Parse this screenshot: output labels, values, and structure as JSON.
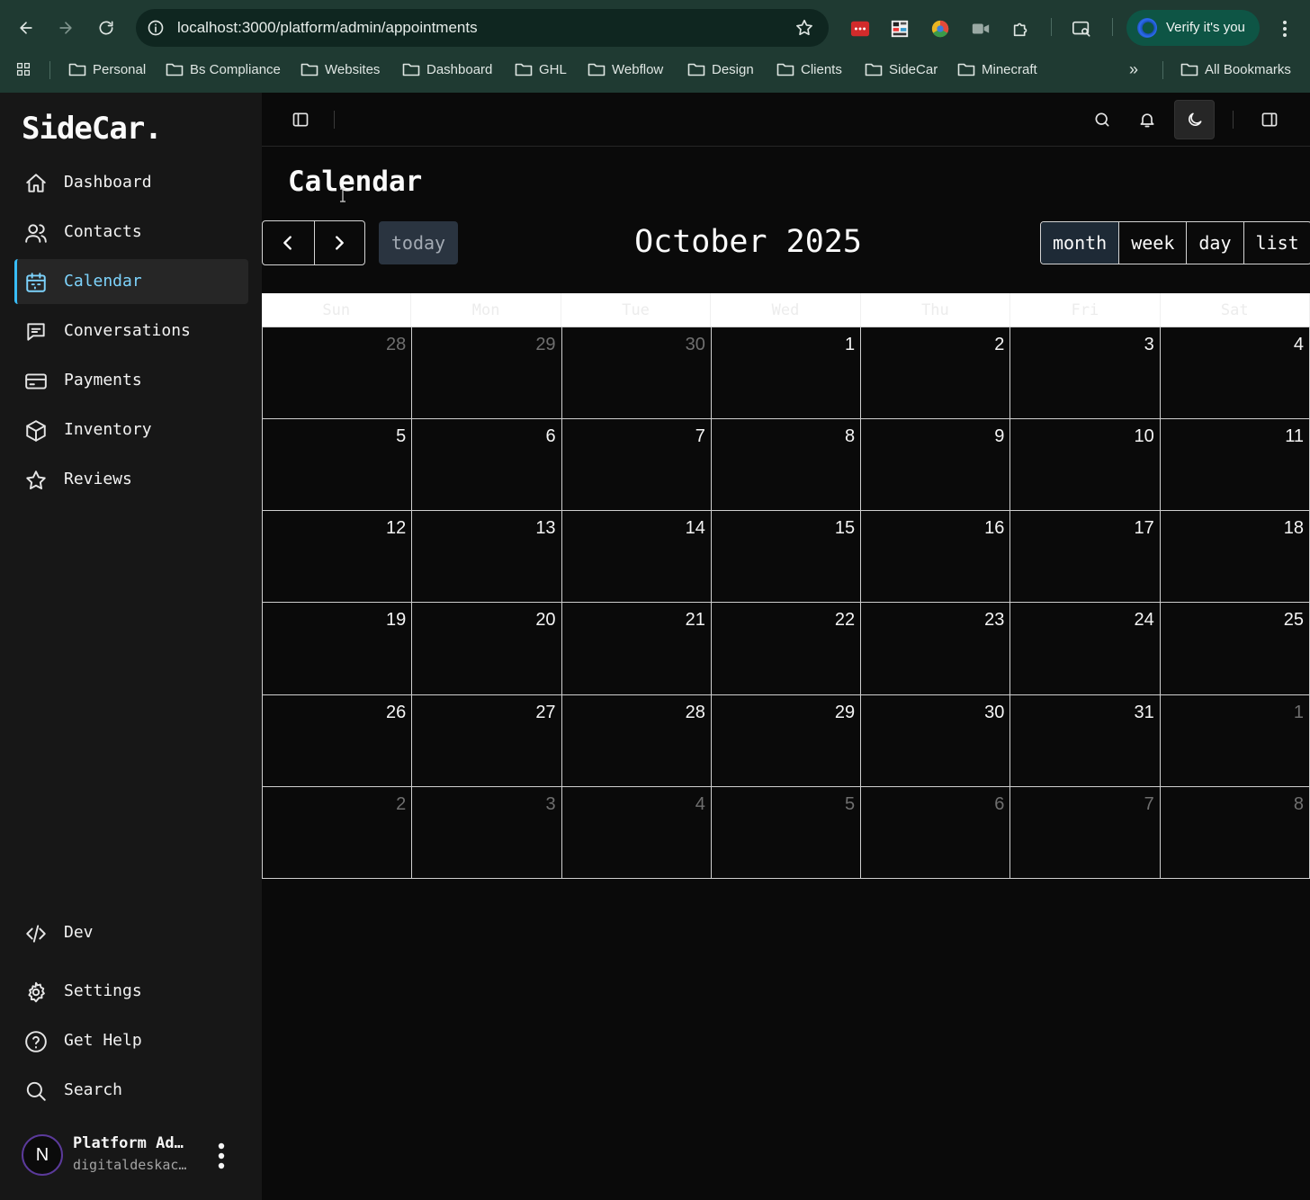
{
  "browser": {
    "url": "localhost:3000/platform/admin/appointments",
    "verify_label": "Verify it's you",
    "bookmarks": [
      "Personal",
      "Bs Compliance",
      "Websites",
      "Dashboard",
      "GHL",
      "Webflow",
      "Design",
      "Clients",
      "SideCar",
      "Minecraft"
    ],
    "all_bookmarks": "All Bookmarks"
  },
  "sidebar": {
    "brand": "SideCar.",
    "nav": [
      {
        "label": "Dashboard",
        "icon": "home-icon"
      },
      {
        "label": "Contacts",
        "icon": "users-icon"
      },
      {
        "label": "Calendar",
        "icon": "calendar-icon",
        "active": true
      },
      {
        "label": "Conversations",
        "icon": "message-icon"
      },
      {
        "label": "Payments",
        "icon": "credit-card-icon"
      },
      {
        "label": "Inventory",
        "icon": "package-icon"
      },
      {
        "label": "Reviews",
        "icon": "star-icon"
      }
    ],
    "bottom": [
      {
        "label": "Dev",
        "icon": "code-icon"
      },
      {
        "label": "Settings",
        "icon": "gear-icon"
      },
      {
        "label": "Get Help",
        "icon": "help-icon"
      },
      {
        "label": "Search",
        "icon": "search-icon"
      }
    ],
    "user": {
      "initial": "N",
      "name": "Platform Ad…",
      "email": "digitaldeskac…"
    }
  },
  "page": {
    "title": "Calendar"
  },
  "calendar": {
    "today_label": "today",
    "month_title": "October 2025",
    "views": [
      "month",
      "week",
      "day",
      "list"
    ],
    "active_view": "month",
    "weekdays": [
      "Sun",
      "Mon",
      "Tue",
      "Wed",
      "Thu",
      "Fri",
      "Sat"
    ],
    "weeks": [
      [
        {
          "d": "28",
          "o": true
        },
        {
          "d": "29",
          "o": true
        },
        {
          "d": "30",
          "o": true
        },
        {
          "d": "1"
        },
        {
          "d": "2"
        },
        {
          "d": "3"
        },
        {
          "d": "4"
        }
      ],
      [
        {
          "d": "5"
        },
        {
          "d": "6"
        },
        {
          "d": "7"
        },
        {
          "d": "8"
        },
        {
          "d": "9"
        },
        {
          "d": "10"
        },
        {
          "d": "11"
        }
      ],
      [
        {
          "d": "12"
        },
        {
          "d": "13"
        },
        {
          "d": "14"
        },
        {
          "d": "15"
        },
        {
          "d": "16"
        },
        {
          "d": "17"
        },
        {
          "d": "18"
        }
      ],
      [
        {
          "d": "19"
        },
        {
          "d": "20"
        },
        {
          "d": "21"
        },
        {
          "d": "22"
        },
        {
          "d": "23"
        },
        {
          "d": "24"
        },
        {
          "d": "25"
        }
      ],
      [
        {
          "d": "26"
        },
        {
          "d": "27"
        },
        {
          "d": "28"
        },
        {
          "d": "29"
        },
        {
          "d": "30"
        },
        {
          "d": "31"
        },
        {
          "d": "1",
          "o": true
        }
      ],
      [
        {
          "d": "2",
          "o": true
        },
        {
          "d": "3",
          "o": true
        },
        {
          "d": "4",
          "o": true
        },
        {
          "d": "5",
          "o": true
        },
        {
          "d": "6",
          "o": true
        },
        {
          "d": "7",
          "o": true
        },
        {
          "d": "8",
          "o": true
        }
      ]
    ]
  },
  "colors": {
    "accent": "#38bdf8",
    "chrome": "#1f3a32",
    "sidebar": "#171717",
    "main": "#0a0a0a"
  }
}
